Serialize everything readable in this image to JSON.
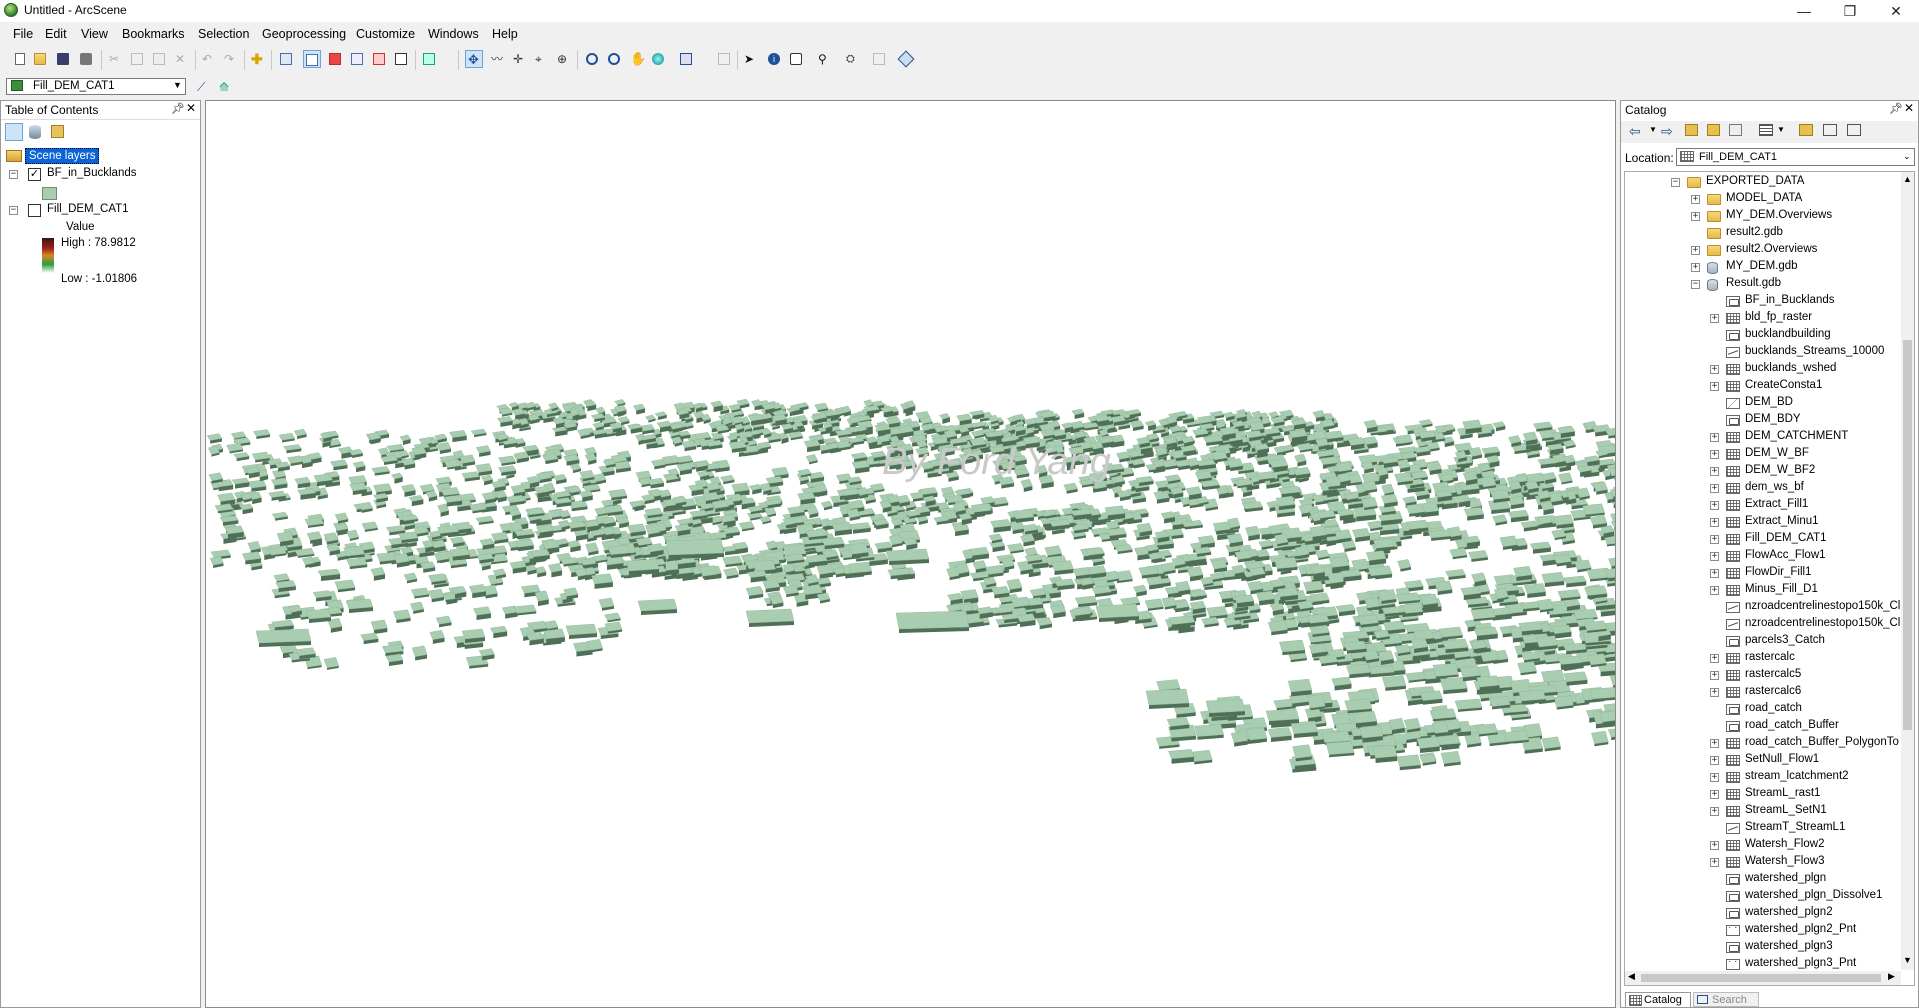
{
  "window": {
    "title": "Untitled - ArcScene"
  },
  "menu": [
    "File",
    "Edit",
    "View",
    "Bookmarks",
    "Selection",
    "Geoprocessing",
    "Customize",
    "Windows",
    "Help"
  ],
  "layer_dropdown": {
    "value": "Fill_DEM_CAT1"
  },
  "toc": {
    "title": "Table of Contents",
    "root": "Scene layers",
    "layers": [
      {
        "name": "BF_in_Bucklands",
        "checked": true
      },
      {
        "name": "Fill_DEM_CAT1",
        "checked": false
      }
    ],
    "legend": {
      "field": "Value",
      "high": "High : 78.9812",
      "low": "Low : -1.01806"
    }
  },
  "viewer": {
    "watermark": "By Ford Yang"
  },
  "catalog": {
    "title": "Catalog",
    "location_label": "Location:",
    "location_value": "Fill_DEM_CAT1",
    "tabs": [
      "Catalog",
      "Search"
    ],
    "items": [
      {
        "label": "EXPORTED_DATA",
        "icon": "folder",
        "level": 0,
        "exp": "-"
      },
      {
        "label": "MODEL_DATA",
        "icon": "folder",
        "level": 1,
        "exp": "+"
      },
      {
        "label": "MY_DEM.Overviews",
        "icon": "folder",
        "level": 1,
        "exp": "+"
      },
      {
        "label": "result2.gdb",
        "icon": "folder",
        "level": 1,
        "exp": ""
      },
      {
        "label": "result2.Overviews",
        "icon": "folder",
        "level": 1,
        "exp": "+"
      },
      {
        "label": "MY_DEM.gdb",
        "icon": "gdb",
        "level": 1,
        "exp": "+"
      },
      {
        "label": "Result.gdb",
        "icon": "gdb",
        "level": 1,
        "exp": "-"
      },
      {
        "label": "BF_in_Bucklands",
        "icon": "fc-poly",
        "level": 2,
        "exp": ""
      },
      {
        "label": "bld_fp_raster",
        "icon": "raster",
        "level": 2,
        "exp": "+"
      },
      {
        "label": "bucklandbuilding",
        "icon": "fc-poly",
        "level": 2,
        "exp": ""
      },
      {
        "label": "bucklands_Streams_10000",
        "icon": "fc-line",
        "level": 2,
        "exp": ""
      },
      {
        "label": "bucklands_wshed",
        "icon": "raster",
        "level": 2,
        "exp": "+"
      },
      {
        "label": "CreateConsta1",
        "icon": "raster",
        "level": 2,
        "exp": "+"
      },
      {
        "label": "DEM_BD",
        "icon": "tin",
        "level": 2,
        "exp": ""
      },
      {
        "label": "DEM_BDY",
        "icon": "fc-poly",
        "level": 2,
        "exp": ""
      },
      {
        "label": "DEM_CATCHMENT",
        "icon": "raster",
        "level": 2,
        "exp": "+"
      },
      {
        "label": "DEM_W_BF",
        "icon": "raster",
        "level": 2,
        "exp": "+"
      },
      {
        "label": "DEM_W_BF2",
        "icon": "raster",
        "level": 2,
        "exp": "+"
      },
      {
        "label": "dem_ws_bf",
        "icon": "raster",
        "level": 2,
        "exp": "+"
      },
      {
        "label": "Extract_Fill1",
        "icon": "raster",
        "level": 2,
        "exp": "+"
      },
      {
        "label": "Extract_Minu1",
        "icon": "raster",
        "level": 2,
        "exp": "+"
      },
      {
        "label": "Fill_DEM_CAT1",
        "icon": "raster",
        "level": 2,
        "exp": "+"
      },
      {
        "label": "FlowAcc_Flow1",
        "icon": "raster",
        "level": 2,
        "exp": "+"
      },
      {
        "label": "FlowDir_Fill1",
        "icon": "raster",
        "level": 2,
        "exp": "+"
      },
      {
        "label": "Minus_Fill_D1",
        "icon": "raster",
        "level": 2,
        "exp": "+"
      },
      {
        "label": "nzroadcentrelinestopo150k_Cl",
        "icon": "fc-line",
        "level": 2,
        "exp": ""
      },
      {
        "label": "nzroadcentrelinestopo150k_Cl",
        "icon": "fc-line",
        "level": 2,
        "exp": ""
      },
      {
        "label": "parcels3_Catch",
        "icon": "fc-poly",
        "level": 2,
        "exp": ""
      },
      {
        "label": "rastercalc",
        "icon": "raster",
        "level": 2,
        "exp": "+"
      },
      {
        "label": "rastercalc5",
        "icon": "raster",
        "level": 2,
        "exp": "+"
      },
      {
        "label": "rastercalc6",
        "icon": "raster",
        "level": 2,
        "exp": "+"
      },
      {
        "label": "road_catch",
        "icon": "fc-poly",
        "level": 2,
        "exp": ""
      },
      {
        "label": "road_catch_Buffer",
        "icon": "fc-poly",
        "level": 2,
        "exp": ""
      },
      {
        "label": "road_catch_Buffer_PolygonTo",
        "icon": "raster",
        "level": 2,
        "exp": "+"
      },
      {
        "label": "SetNull_Flow1",
        "icon": "raster",
        "level": 2,
        "exp": "+"
      },
      {
        "label": "stream_lcatchment2",
        "icon": "raster",
        "level": 2,
        "exp": "+"
      },
      {
        "label": "StreamL_rast1",
        "icon": "raster",
        "level": 2,
        "exp": "+"
      },
      {
        "label": "StreamL_SetN1",
        "icon": "raster",
        "level": 2,
        "exp": "+"
      },
      {
        "label": "StreamT_StreamL1",
        "icon": "fc-line",
        "level": 2,
        "exp": ""
      },
      {
        "label": "Watersh_Flow2",
        "icon": "raster",
        "level": 2,
        "exp": "+"
      },
      {
        "label": "Watersh_Flow3",
        "icon": "raster",
        "level": 2,
        "exp": "+"
      },
      {
        "label": "watershed_plgn",
        "icon": "fc-poly",
        "level": 2,
        "exp": ""
      },
      {
        "label": "watershed_plgn_Dissolve1",
        "icon": "fc-poly",
        "level": 2,
        "exp": ""
      },
      {
        "label": "watershed_plgn2",
        "icon": "fc-poly",
        "level": 2,
        "exp": ""
      },
      {
        "label": "watershed_plgn2_Pnt",
        "icon": "fc-pt",
        "level": 2,
        "exp": ""
      },
      {
        "label": "watershed_plgn3",
        "icon": "fc-poly",
        "level": 2,
        "exp": ""
      },
      {
        "label": "watershed_plgn3_Pnt",
        "icon": "fc-pt",
        "level": 2,
        "exp": ""
      }
    ]
  },
  "colors": {
    "building": "#a9cdb0",
    "building_dark": "#4f6f56",
    "selection": "#0a64d8",
    "background": "#ffffff"
  }
}
